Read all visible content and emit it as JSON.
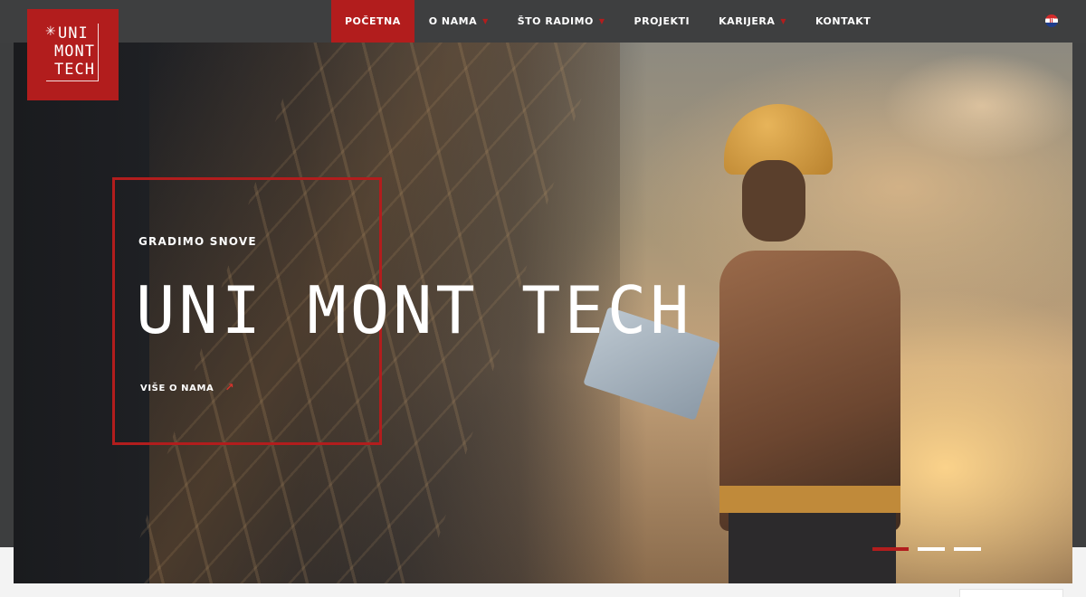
{
  "brand": {
    "line1": "UNI",
    "line2": "MONT",
    "line3": "TECH",
    "color": "#b21d1d"
  },
  "nav": {
    "items": [
      {
        "label": "POČETNA",
        "active": true,
        "dropdown": false
      },
      {
        "label": "O NAMA",
        "active": false,
        "dropdown": true
      },
      {
        "label": "ŠTO RADIMO",
        "active": false,
        "dropdown": true
      },
      {
        "label": "PROJEKTI",
        "active": false,
        "dropdown": false
      },
      {
        "label": "KARIJERA",
        "active": false,
        "dropdown": true
      },
      {
        "label": "KONTAKT",
        "active": false,
        "dropdown": false
      }
    ],
    "language_icon": "croatia-flag-icon"
  },
  "hero": {
    "tagline": "GRADIMO SNOVE",
    "title": "UNI MONT TECH",
    "link_label": "VIŠE O NAMA",
    "link_icon": "arrow-up-right-icon",
    "slides": 3,
    "active_slide": 1
  },
  "colors": {
    "accent": "#b21d1d",
    "topbar": "#3e3f40"
  }
}
